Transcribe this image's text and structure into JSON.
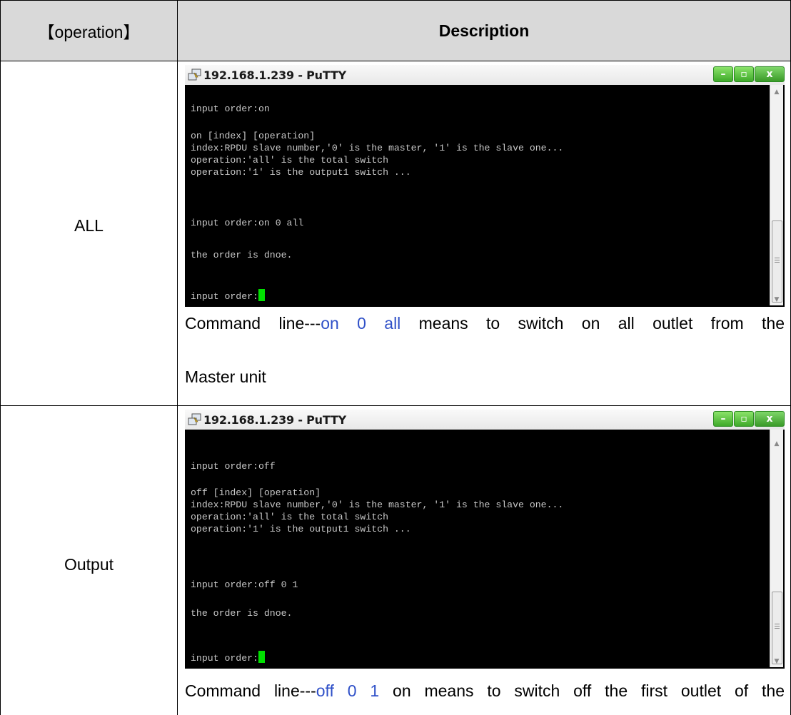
{
  "header": {
    "operation": "【operation】",
    "description": "Description"
  },
  "rows": [
    {
      "operation": "ALL",
      "putty": {
        "title": "192.168.1.239 - PuTTY",
        "lines": [
          "input order:on",
          "on [index] [operation]",
          "index:RPDU slave number,'0' is the master, '1' is the slave one...",
          "operation:'all' is the total switch",
          "operation:'1' is the output1 switch ...",
          "input order:on 0 all",
          "the order is dnoe.",
          "input order:"
        ]
      },
      "desc": {
        "prefix": "Command line---",
        "command": "on 0 all",
        "suffix": " means to switch on all outlet from the",
        "line2": "Master unit"
      }
    },
    {
      "operation": "Output",
      "putty": {
        "title": "192.168.1.239 - PuTTY",
        "lines": [
          "input order:off",
          "off [index] [operation]",
          "index:RPDU slave number,'0' is the master, '1' is the slave one...",
          "operation:'all' is the total switch",
          "operation:'1' is the output1 switch ...",
          "input order:off 0 1",
          "the order is dnoe.",
          "input order:"
        ]
      },
      "desc": {
        "prefix": "Command line---",
        "command": "off 0 1",
        "suffix": " on means to switch off the first outlet of the"
      }
    }
  ],
  "colors": {
    "header_bg": "#d9d9d9",
    "terminal_bg": "#000000",
    "terminal_text": "#c8c8c8",
    "cursor": "#00e000",
    "command_highlight": "#2f50c8"
  },
  "icons": [
    "putty-icon",
    "minimize-icon",
    "maximize-icon",
    "close-icon",
    "scroll-up-icon",
    "scroll-down-icon"
  ]
}
